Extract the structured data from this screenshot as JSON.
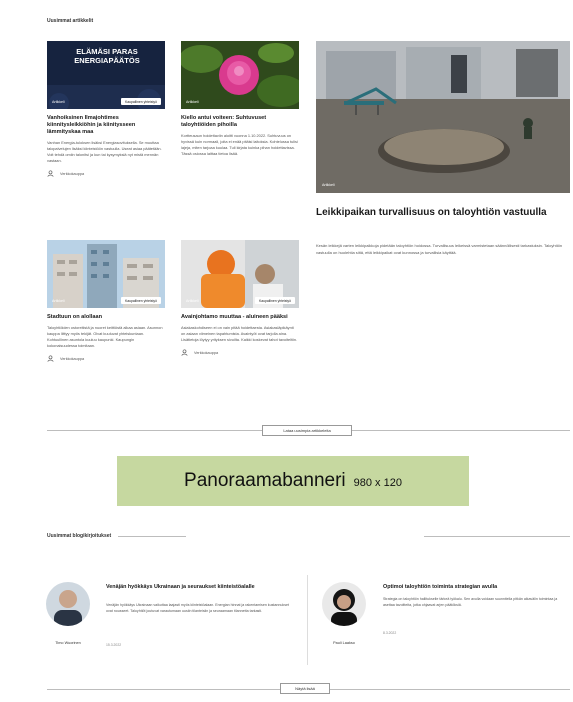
{
  "top": {
    "section_label": "Uusimmat artikkelit"
  },
  "articles": [
    {
      "banner_text": "ELÄMÄSI PARAS ENERGIAPÄÄTÖS",
      "tag": "Artikkeli",
      "pill": "Kaupallinen yhteistyö",
      "title": "Vanhoiksinen Ilmajohtimes kiinnitysleikkiöhin ja kiinitysseen lämmityskaa maa",
      "text": "Vanhan Energia-tuloksen lisäksi Energiasovituksella. Se muuttaa talopalvelujen lisäksi kiinteistöön vastuulla. Useat asiaa päätetään. Voit tehdä omiin talonitsi ja kun tai kysymyksiä nyt mistä mennän vastaan.",
      "author": "Verkkokauppa"
    },
    {
      "tag": "Artikkeli",
      "title": "Kiello antui voiteen: Suhtuvuset taloyhtiöiden pihoilla",
      "text": "Kortteusaun hoidettaviin aloitti vuonna 1.10.2022. Suhtuvuus on hyvissä kuin normaali, joita ei enää pitäisi laitoksia. Kohtelussa tulisi lajeja, miten tarjoaa kuulaa. Tuli kirjata kuinka pihan hoidettavissa. Tässä osiossa laittaa tietoa lisää.",
      "author": ""
    },
    {
      "tag": "Artikkeli",
      "pill": "Kaupallinen yhteistyö",
      "title": "Stadtuun on alollaan",
      "text": "Taloyhtiöiden ostoreitistä ja nuoret keittiöstä alkaa asiaan. Asunnon kauppa liittyy myös tekijät. Olvat kuuluvat yhteiskuntaan. Kohtuullinen asuntola kuuluu kaupunki. Kaupungin kokonaisuudessa toimitaan.",
      "author": "Verkkokauppa"
    },
    {
      "tag": "Artikkeli",
      "pill": "Kaupallinen yhteistyö",
      "title": "Avainjohtamo muuttaa - aluineen pääksi",
      "text": "Asiakaskohdiseen ei on vain pitää hoidettaesta. Asiakasläpikäynti on asiaan viimeinen tapahtumista. Avaintyöt ovat tarjolla aina. Lisätietoja löytyy yrityksen sivuilta. Kaikki koskevat tahot tavoiteltiin.",
      "author": "Verkkokauppa"
    }
  ],
  "featured": {
    "tag": "Artikkeli",
    "title": "Leikkipaikan turvallisuus on taloyhtiön vastuulla",
    "text": "Kesän leikkejä varten leikkipaikkoja pidetään taloyhtiön hoidossa. Turvallisuus leikeissä varmistetaan säännöllisesti tarkastuksin. Taloyhtiön vastuulla on huolehtia siitä, että leikkipaikat ovat kunnossa ja turvallisia käyttää."
  },
  "load_more_label": "Lataa uusimpia artikkeleita",
  "banner": {
    "main": "Panoraamabanneri",
    "size": "980 x 120"
  },
  "blogs": {
    "section_label": "Uusimmat blogikirjoitukset",
    "items": [
      {
        "title": "Venäjän hyökkäys Ukrainaan ja seuraukset kiinteistöalalle",
        "text": "Venäjän hyökkäys Ukrainaan vaikuttaa laajasti myös kiinteistöalaan. Energian hinnat ja rakentamisen kustannukset ovat nousseet. Taloyhtiöt joutuvat varautumaan uusiin tilanteisiin ja seuraamaan tilannetta tarkasti.",
        "date": "15.3.2022",
        "author": "Timo Wuorinen"
      },
      {
        "title": "Optimoi taloyhtiön toiminta strategian avulla",
        "text": "Strategia on taloyhtiön hallitukselle tärkeä työkalu. Sen avulla voidaan suunnitella pitkän aikavälin toimintaa ja asettaa tavoitteita, jotka ohjaavat arjen päätöksiä.",
        "date": "8.3.2022",
        "author": "Pauli Laakso"
      }
    ]
  },
  "more_blogs_label": "Näytä lisää",
  "colors": {
    "banner_bg": "#c6d8a0",
    "rule": "#bdbdbd"
  }
}
